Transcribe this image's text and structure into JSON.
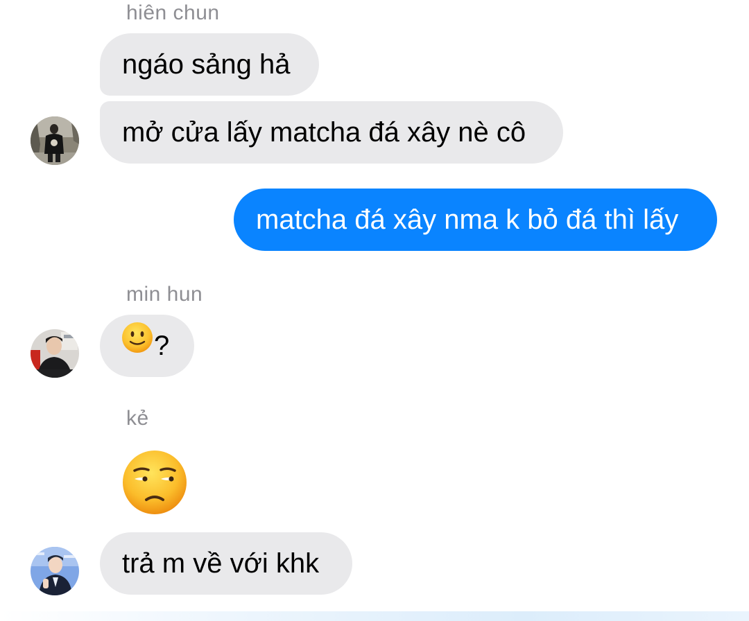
{
  "conversation": {
    "groups": [
      {
        "sender": "hiên chun",
        "messages": [
          "ngáo sảng hả",
          "mở cửa lấy matcha đá xây nè cô"
        ]
      },
      {
        "sender": "",
        "outgoing": true,
        "messages": [
          "matcha đá xây nma k bỏ đá thì lấy"
        ]
      },
      {
        "sender": "min hun",
        "messages": [
          "?"
        ],
        "emoji": "slightly-smiling-face"
      },
      {
        "sender": "kẻ",
        "emoji": "unamused-face",
        "messages": [
          "trả m về với khk"
        ]
      }
    ]
  },
  "colors": {
    "incoming_bubble": "#e9e9eb",
    "outgoing_bubble": "#0a84ff",
    "sender_name": "#8e8e93",
    "background": "#ffffff"
  }
}
